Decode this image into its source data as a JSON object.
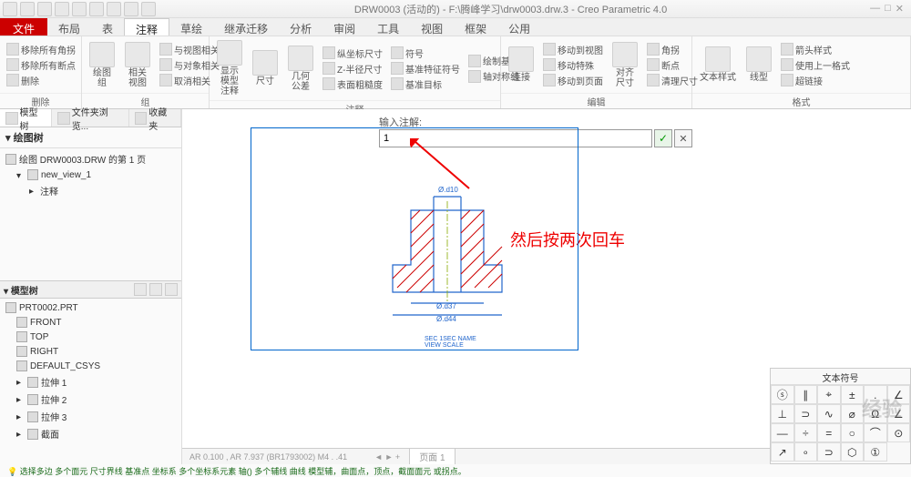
{
  "title": "DRW0003 (活动的) - F:\\腾峰学习\\drw0003.drw.3 - Creo Parametric 4.0",
  "menus": {
    "file": "文件",
    "items": [
      "布局",
      "表",
      "注释",
      "草绘",
      "继承迁移",
      "分析",
      "审阅",
      "工具",
      "视图",
      "框架",
      "公用"
    ],
    "activeIndex": 2
  },
  "ribbon": {
    "deleteGroup": {
      "item1": "移除所有角拐",
      "item2": "移除所有断点",
      "item3": "删除",
      "label": "删除"
    },
    "zuGroup": {
      "btn1": "绘图组",
      "btn2": "相关视图",
      "item1": "与视图相关",
      "item2": "与对象相关",
      "item3": "取消相关",
      "label": "组"
    },
    "zhushiGroup": {
      "showBtn": "显示模型\n注释",
      "sizeBtn": "尺寸",
      "geomBtn": "几何公差",
      "item1": "纵坐标尺寸",
      "item2": "Z-半径尺寸",
      "item3": "表面粗糙度",
      "item4": "符号",
      "item5": "基准特征符号",
      "item6": "基准目标",
      "item7": "绘制基准",
      "item8": "轴对称线",
      "label": "注释"
    },
    "bianjiGroup": {
      "btn1": "连接",
      "item1": "移动到视图",
      "item2": "移动特殊",
      "item3": "移动到页面",
      "btn2": "对齐尺寸",
      "item4": "角拐",
      "item5": "断点",
      "item6": "清理尺寸",
      "label": "编辑"
    },
    "geshiGroup": {
      "btn1": "文本样式",
      "btn2": "线型",
      "item1": "箭头样式",
      "item2": "使用上一格式",
      "item3": "超链接",
      "label": "格式"
    }
  },
  "sidebar": {
    "tab1": "模型树",
    "tab2": "文件夹浏览...",
    "tab3": "收藏夹",
    "header1": "绘图树",
    "drawing": "绘图 DRW0003.DRW 的第 1 页",
    "view": "new_view_1",
    "annotation": "注释",
    "header2": "模型树",
    "part": "PRT0002.PRT",
    "items": [
      "FRONT",
      "TOP",
      "RIGHT",
      "DEFAULT_CSYS",
      "拉伸 1",
      "拉伸 2",
      "拉伸 3",
      "截面"
    ]
  },
  "input": {
    "label": "输入注解:",
    "value": "1"
  },
  "hint": "然后按两次回车",
  "drawing": {
    "dim1": "Ø.d10",
    "dim2": "Ø.d37",
    "dim3": "Ø.d44",
    "section": "SEC 1SEC NAME\nVIEW SCALE"
  },
  "statusbar": {
    "coords": "AR 0.100 , AR 7.937 (BR1793002) M4 . .41",
    "page": "页面 1"
  },
  "bottomHint": "选择多边 多个面元 尺寸界线 基准点 坐标系 多个坐标系元素 轴() 多个辅线 曲线 模型辅，曲面点，顶点，截面面元 或拐点。",
  "symbolPane": {
    "header": "文本符号",
    "symbols": [
      "ⓢ",
      "∥",
      "⌖",
      "±",
      ".",
      "∠",
      "⊥",
      "⊃",
      "∿",
      "⌀",
      "Ω",
      "∠",
      "—",
      "÷",
      "=",
      "○",
      "⌒",
      "⊙",
      "↗",
      "∘",
      "⊃",
      "⬡",
      "①"
    ]
  },
  "watermark": "经验"
}
